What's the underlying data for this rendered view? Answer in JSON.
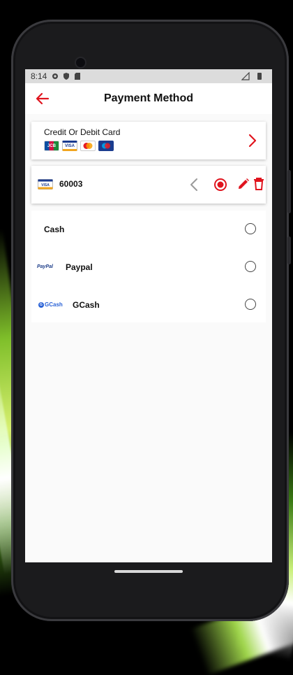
{
  "status_bar": {
    "time": "8:14"
  },
  "app_bar": {
    "title": "Payment Method"
  },
  "card_option": {
    "label": "Credit Or Debit Card",
    "brands": [
      "JCB",
      "VISA",
      "MasterCard",
      "Maestro"
    ]
  },
  "saved_card": {
    "brand": "VISA",
    "number": "60003",
    "selected": true
  },
  "payment_options": [
    {
      "label": "Cash",
      "logo": "",
      "selected": false
    },
    {
      "label": "Paypal",
      "logo": "PayPal",
      "selected": false
    },
    {
      "label": "GCash",
      "logo": "GCash",
      "selected": false
    }
  ],
  "colors": {
    "accent": "#e0141e",
    "screen_bg": "#fafafa",
    "card_bg": "#ffffff"
  },
  "icons": {
    "back": "arrow-left-icon",
    "card_chevron": "chevron-right-icon",
    "saved_prev": "chevron-left-icon",
    "selected_radio": "radio-checked-icon",
    "edit": "pencil-icon",
    "delete": "trash-icon"
  }
}
